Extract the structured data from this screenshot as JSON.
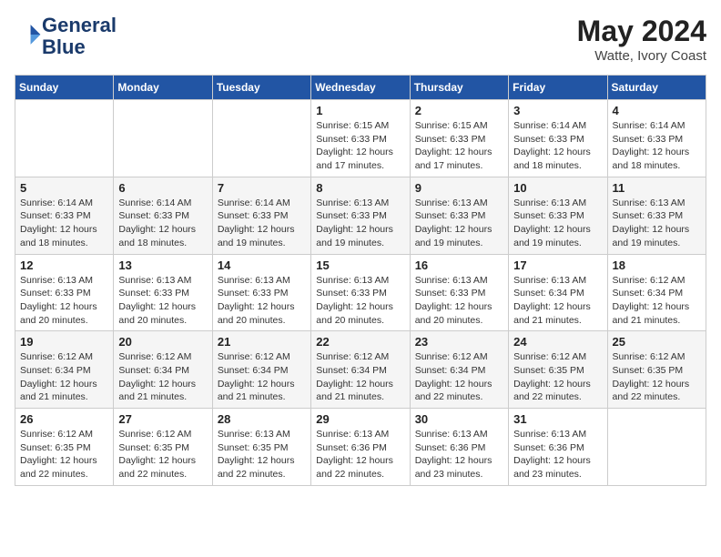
{
  "header": {
    "logo_line1": "General",
    "logo_line2": "Blue",
    "month_year": "May 2024",
    "location": "Watte, Ivory Coast"
  },
  "weekdays": [
    "Sunday",
    "Monday",
    "Tuesday",
    "Wednesday",
    "Thursday",
    "Friday",
    "Saturday"
  ],
  "weeks": [
    [
      {
        "day": "",
        "info": ""
      },
      {
        "day": "",
        "info": ""
      },
      {
        "day": "",
        "info": ""
      },
      {
        "day": "1",
        "info": "Sunrise: 6:15 AM\nSunset: 6:33 PM\nDaylight: 12 hours\nand 17 minutes."
      },
      {
        "day": "2",
        "info": "Sunrise: 6:15 AM\nSunset: 6:33 PM\nDaylight: 12 hours\nand 17 minutes."
      },
      {
        "day": "3",
        "info": "Sunrise: 6:14 AM\nSunset: 6:33 PM\nDaylight: 12 hours\nand 18 minutes."
      },
      {
        "day": "4",
        "info": "Sunrise: 6:14 AM\nSunset: 6:33 PM\nDaylight: 12 hours\nand 18 minutes."
      }
    ],
    [
      {
        "day": "5",
        "info": "Sunrise: 6:14 AM\nSunset: 6:33 PM\nDaylight: 12 hours\nand 18 minutes."
      },
      {
        "day": "6",
        "info": "Sunrise: 6:14 AM\nSunset: 6:33 PM\nDaylight: 12 hours\nand 18 minutes."
      },
      {
        "day": "7",
        "info": "Sunrise: 6:14 AM\nSunset: 6:33 PM\nDaylight: 12 hours\nand 19 minutes."
      },
      {
        "day": "8",
        "info": "Sunrise: 6:13 AM\nSunset: 6:33 PM\nDaylight: 12 hours\nand 19 minutes."
      },
      {
        "day": "9",
        "info": "Sunrise: 6:13 AM\nSunset: 6:33 PM\nDaylight: 12 hours\nand 19 minutes."
      },
      {
        "day": "10",
        "info": "Sunrise: 6:13 AM\nSunset: 6:33 PM\nDaylight: 12 hours\nand 19 minutes."
      },
      {
        "day": "11",
        "info": "Sunrise: 6:13 AM\nSunset: 6:33 PM\nDaylight: 12 hours\nand 19 minutes."
      }
    ],
    [
      {
        "day": "12",
        "info": "Sunrise: 6:13 AM\nSunset: 6:33 PM\nDaylight: 12 hours\nand 20 minutes."
      },
      {
        "day": "13",
        "info": "Sunrise: 6:13 AM\nSunset: 6:33 PM\nDaylight: 12 hours\nand 20 minutes."
      },
      {
        "day": "14",
        "info": "Sunrise: 6:13 AM\nSunset: 6:33 PM\nDaylight: 12 hours\nand 20 minutes."
      },
      {
        "day": "15",
        "info": "Sunrise: 6:13 AM\nSunset: 6:33 PM\nDaylight: 12 hours\nand 20 minutes."
      },
      {
        "day": "16",
        "info": "Sunrise: 6:13 AM\nSunset: 6:33 PM\nDaylight: 12 hours\nand 20 minutes."
      },
      {
        "day": "17",
        "info": "Sunrise: 6:13 AM\nSunset: 6:34 PM\nDaylight: 12 hours\nand 21 minutes."
      },
      {
        "day": "18",
        "info": "Sunrise: 6:12 AM\nSunset: 6:34 PM\nDaylight: 12 hours\nand 21 minutes."
      }
    ],
    [
      {
        "day": "19",
        "info": "Sunrise: 6:12 AM\nSunset: 6:34 PM\nDaylight: 12 hours\nand 21 minutes."
      },
      {
        "day": "20",
        "info": "Sunrise: 6:12 AM\nSunset: 6:34 PM\nDaylight: 12 hours\nand 21 minutes."
      },
      {
        "day": "21",
        "info": "Sunrise: 6:12 AM\nSunset: 6:34 PM\nDaylight: 12 hours\nand 21 minutes."
      },
      {
        "day": "22",
        "info": "Sunrise: 6:12 AM\nSunset: 6:34 PM\nDaylight: 12 hours\nand 21 minutes."
      },
      {
        "day": "23",
        "info": "Sunrise: 6:12 AM\nSunset: 6:34 PM\nDaylight: 12 hours\nand 22 minutes."
      },
      {
        "day": "24",
        "info": "Sunrise: 6:12 AM\nSunset: 6:35 PM\nDaylight: 12 hours\nand 22 minutes."
      },
      {
        "day": "25",
        "info": "Sunrise: 6:12 AM\nSunset: 6:35 PM\nDaylight: 12 hours\nand 22 minutes."
      }
    ],
    [
      {
        "day": "26",
        "info": "Sunrise: 6:12 AM\nSunset: 6:35 PM\nDaylight: 12 hours\nand 22 minutes."
      },
      {
        "day": "27",
        "info": "Sunrise: 6:12 AM\nSunset: 6:35 PM\nDaylight: 12 hours\nand 22 minutes."
      },
      {
        "day": "28",
        "info": "Sunrise: 6:13 AM\nSunset: 6:35 PM\nDaylight: 12 hours\nand 22 minutes."
      },
      {
        "day": "29",
        "info": "Sunrise: 6:13 AM\nSunset: 6:36 PM\nDaylight: 12 hours\nand 22 minutes."
      },
      {
        "day": "30",
        "info": "Sunrise: 6:13 AM\nSunset: 6:36 PM\nDaylight: 12 hours\nand 23 minutes."
      },
      {
        "day": "31",
        "info": "Sunrise: 6:13 AM\nSunset: 6:36 PM\nDaylight: 12 hours\nand 23 minutes."
      },
      {
        "day": "",
        "info": ""
      }
    ]
  ]
}
